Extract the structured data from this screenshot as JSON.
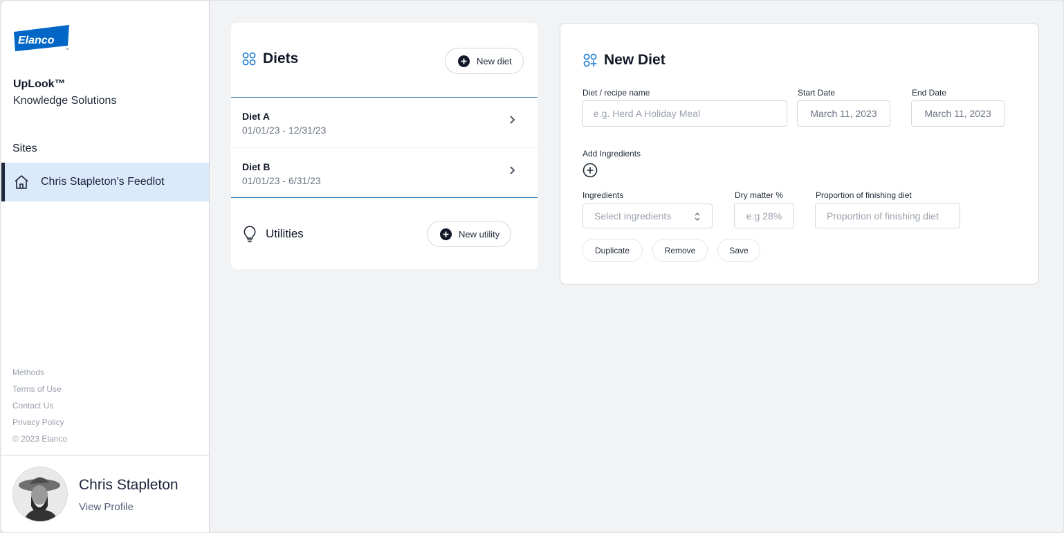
{
  "brand": {
    "logo_text": "Elanco",
    "logo_tm": "TM",
    "logo_color": "#0067c6",
    "product": "UpLook™",
    "subtitle": "Knowledge Solutions"
  },
  "sidebar": {
    "sites_label": "Sites",
    "sites": [
      {
        "label": "Chris Stapleton’s Feedlot",
        "icon": "home-icon",
        "active": true
      }
    ],
    "footer_links": [
      "Methods",
      "Terms of Use",
      "Contact Us",
      "Privacy Policy"
    ],
    "copyright": "© 2023 Elanco"
  },
  "profile": {
    "name": "Chris Stapleton",
    "link": "View Profile"
  },
  "diets_panel": {
    "title": "Diets",
    "icon": "grid-four-circles-icon",
    "new_button": "New diet",
    "items": [
      {
        "name": "Diet A",
        "range": "01/01/23 - 12/31/23"
      },
      {
        "name": "Diet B",
        "range": "01/01/23 - 6/31/23"
      }
    ],
    "utilities_title": "Utilities",
    "utilities_icon": "lightbulb-icon",
    "new_utility_button": "New utility"
  },
  "new_diet": {
    "title": "New Diet",
    "icon": "grid-add-icon",
    "name_label": "Diet / recipe name",
    "name_placeholder": "e.g. Herd A Holiday Meal",
    "start_label": "Start Date",
    "start_value": "March 11, 2023",
    "end_label": "End Date",
    "end_value": "March 11, 2023",
    "add_ingredients_label": "Add Ingredients",
    "ingredients_label": "Ingredients",
    "ingredients_placeholder": "Select ingredients",
    "dry_matter_label": "Dry matter %",
    "dry_matter_placeholder": "e.g 28%",
    "proportion_label": "Proportion of finishing diet",
    "proportion_placeholder": "Proportion of finishing diet",
    "buttons": {
      "duplicate": "Duplicate",
      "remove": "Remove",
      "save": "Save"
    }
  },
  "colors": {
    "accent_blue": "#1a6fb0",
    "active_bg": "#dbe9fd",
    "dark": "#1f2a3c",
    "page_bg": "#f2f3f5"
  }
}
